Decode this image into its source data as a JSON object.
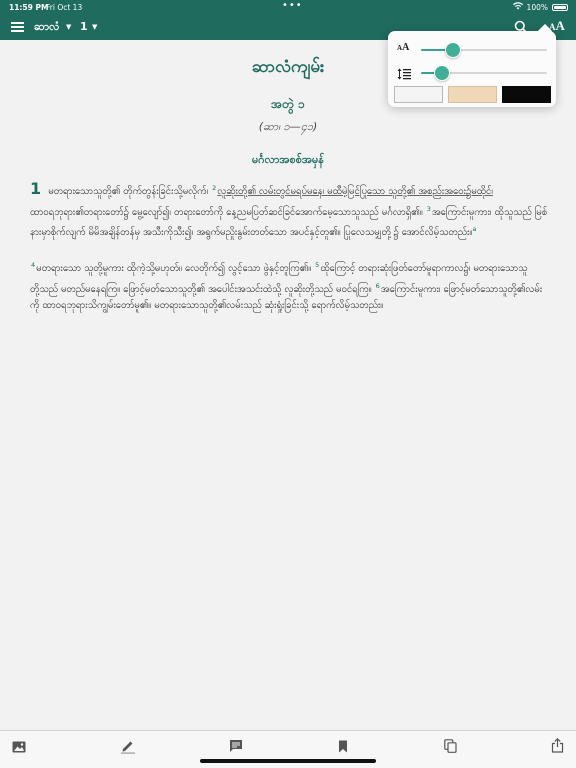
{
  "status_bar": {
    "time": "11:59 PM",
    "date": "Fri Oct 13",
    "dots": "•••",
    "battery": "100%"
  },
  "toolbar": {
    "book": "ဆာလံ",
    "book_caret": "▼",
    "chapter": "1",
    "chapter_caret": "▼",
    "text_settings_label": "A"
  },
  "text_settings": {
    "size_label_small": "A",
    "size_label_large": "A",
    "font_size_level": 0.25,
    "line_spacing_level": 0.17,
    "themes": [
      "white",
      "sepia",
      "black"
    ],
    "theme_colors": {
      "white": "#f4f4f4",
      "sepia": "#efd7b7",
      "black": "#0a0a0a"
    }
  },
  "content": {
    "book_title": "ဆာလံကျမ်း",
    "chapter_title": "အတွဲ ၁",
    "chapter_ref": "(ဆာ၊ ၁—၄၁)",
    "section_heading": "မင်္ဂလာအစစ်အမှန်",
    "chapter_number": "1",
    "verse1": "မတရားသောသူတို့၏ တိုက်တွန်းခြင်းသို့မလိုက်၊",
    "v2_num": "2",
    "verse2a": "လူဆိုးတို့၏ လမ်းတွင်မရပ်မနေ၊ မထီမဲ့မြင်ပြုသော သူတို့၏ အစည်းအဝေး၌မထိုင်၊",
    "verse2b": "ထာဝရဘုရား၏တရားတော်၌ မွေ့လျော်၍၊ တရားတော်ကို နေ့ညမပြတ်ဆင်ခြင်အောက်မေ့သောသူသည် မင်္ဂလာရှိ၏။",
    "v3_num": "3",
    "verse3": "အကြောင်းမူကား၊ ထိုသူသည် မြစ်နားမှာစိုက်လျက် မိမိအချိန်တန်မှ အသီးကိုသီး၍၊ အရွက်မညှိုးနွမ်းတတ်သော အပင်နှင့်တူ၏။ ပြုလေသမျှတို့၌ အောင်လိမ့်သတည်း။",
    "fn_a": "a",
    "v4_num": "4",
    "verse4": "မတရားသော သူတို့မူကား ထိုကဲ့သို့မဟုတ်။ လေတိုက်၍ လွင့်သော ဖွဲနှင့်တူကြ၏။",
    "v5_num": "5",
    "verse5": "ထိုကြောင့် တရားဆုံးဖြတ်တော်မူရာကာလ၌၊ မတရားသောသူတို့သည် မတည်မနေရကြ။ ဖြောင့်မတ်သောသူတို့၏ အပေါင်းအသင်းထဲသို့ လူဆိုးတို့သည် မဝင်ရကြ။",
    "v6_num": "6",
    "verse6": "အကြောင်းမူကား၊ ဖြောင့်မတ်သောသူတို့၏လမ်းကို ထာဝရဘုရားသိကျွမ်းတော်မူ၏။ မတရားသောသူတို့၏လမ်းသည် ဆုံးရှုံးခြင်းသို့ ရောက်လိမ့်သတည်း။"
  },
  "bottom_bar": {
    "icons": [
      "image-icon",
      "pencil-icon",
      "note-icon",
      "bookmark-icon",
      "copy-icon",
      "share-icon"
    ]
  },
  "colors": {
    "accent": "#1f6b5e",
    "slider": "#41ae97",
    "page_background": "#f2f2f2"
  }
}
